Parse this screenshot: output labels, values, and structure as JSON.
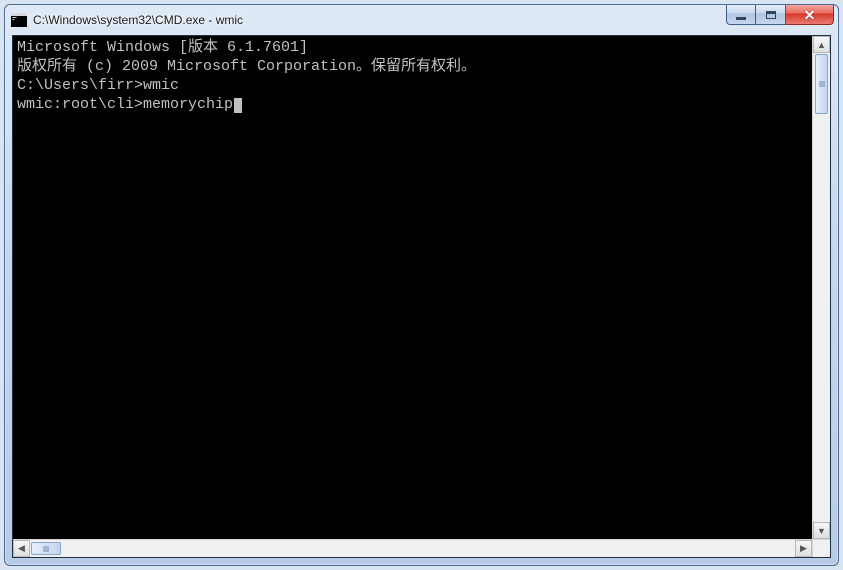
{
  "window": {
    "title": "C:\\Windows\\system32\\CMD.exe - wmic"
  },
  "terminal": {
    "lines": [
      "Microsoft Windows [版本 6.1.7601]",
      "版权所有 (c) 2009 Microsoft Corporation。保留所有权利。",
      "",
      "C:\\Users\\firr>wmic",
      "wmic:root\\cli>memorychip"
    ]
  }
}
